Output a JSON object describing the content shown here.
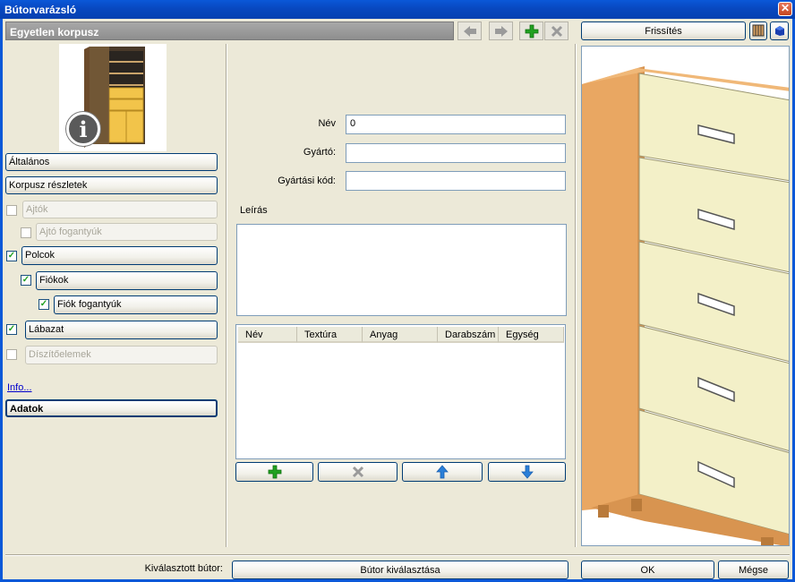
{
  "window": {
    "title": "Bútorvarázsló",
    "close_label": "✕"
  },
  "header": {
    "title": "Egyetlen korpusz",
    "nav": [
      "back-arrow",
      "forward-arrow",
      "add",
      "delete"
    ]
  },
  "sidebar": {
    "buttons": {
      "general": "Általános",
      "body_details": "Korpusz részletek",
      "doors": "Ajtók",
      "door_handles": "Ajtó fogantyúk",
      "shelves": "Polcok",
      "drawers": "Fiókok",
      "drawer_handles": "Fiók fogantyúk",
      "base": "Lábazat",
      "ornaments": "Díszítőelemek",
      "data": "Adatok"
    },
    "checked": {
      "doors": false,
      "door_handles": false,
      "shelves": true,
      "drawers": true,
      "drawer_handles": true,
      "base": true,
      "ornaments": false
    },
    "check_mark": "✓",
    "info_link": "Info...",
    "info_badge": "i"
  },
  "form": {
    "name_label": "Név",
    "name_value": "0",
    "manufacturer_label": "Gyártó",
    "manufacturer_value": "",
    "code_label": "Gyártási kód:",
    "code_value": "",
    "description_label": "Leírás",
    "colon": ":"
  },
  "table": {
    "columns": [
      "Név",
      "Textúra",
      "Anyag",
      "Darabszám",
      "Egység"
    ],
    "rows": []
  },
  "right_panel": {
    "refresh_label": "Frissítés"
  },
  "footer": {
    "selected_label": "Kiválasztott bútor:",
    "select_button": "Bútor kiválasztása",
    "ok_button": "OK",
    "cancel_button": "Mégse"
  },
  "colors": {
    "title_bar": "#0a58d8",
    "accent_green": "#21a121",
    "arrow_blue": "#2a7fd8",
    "drawer_face": "#f3f0c8",
    "wood": "#e9a762"
  }
}
